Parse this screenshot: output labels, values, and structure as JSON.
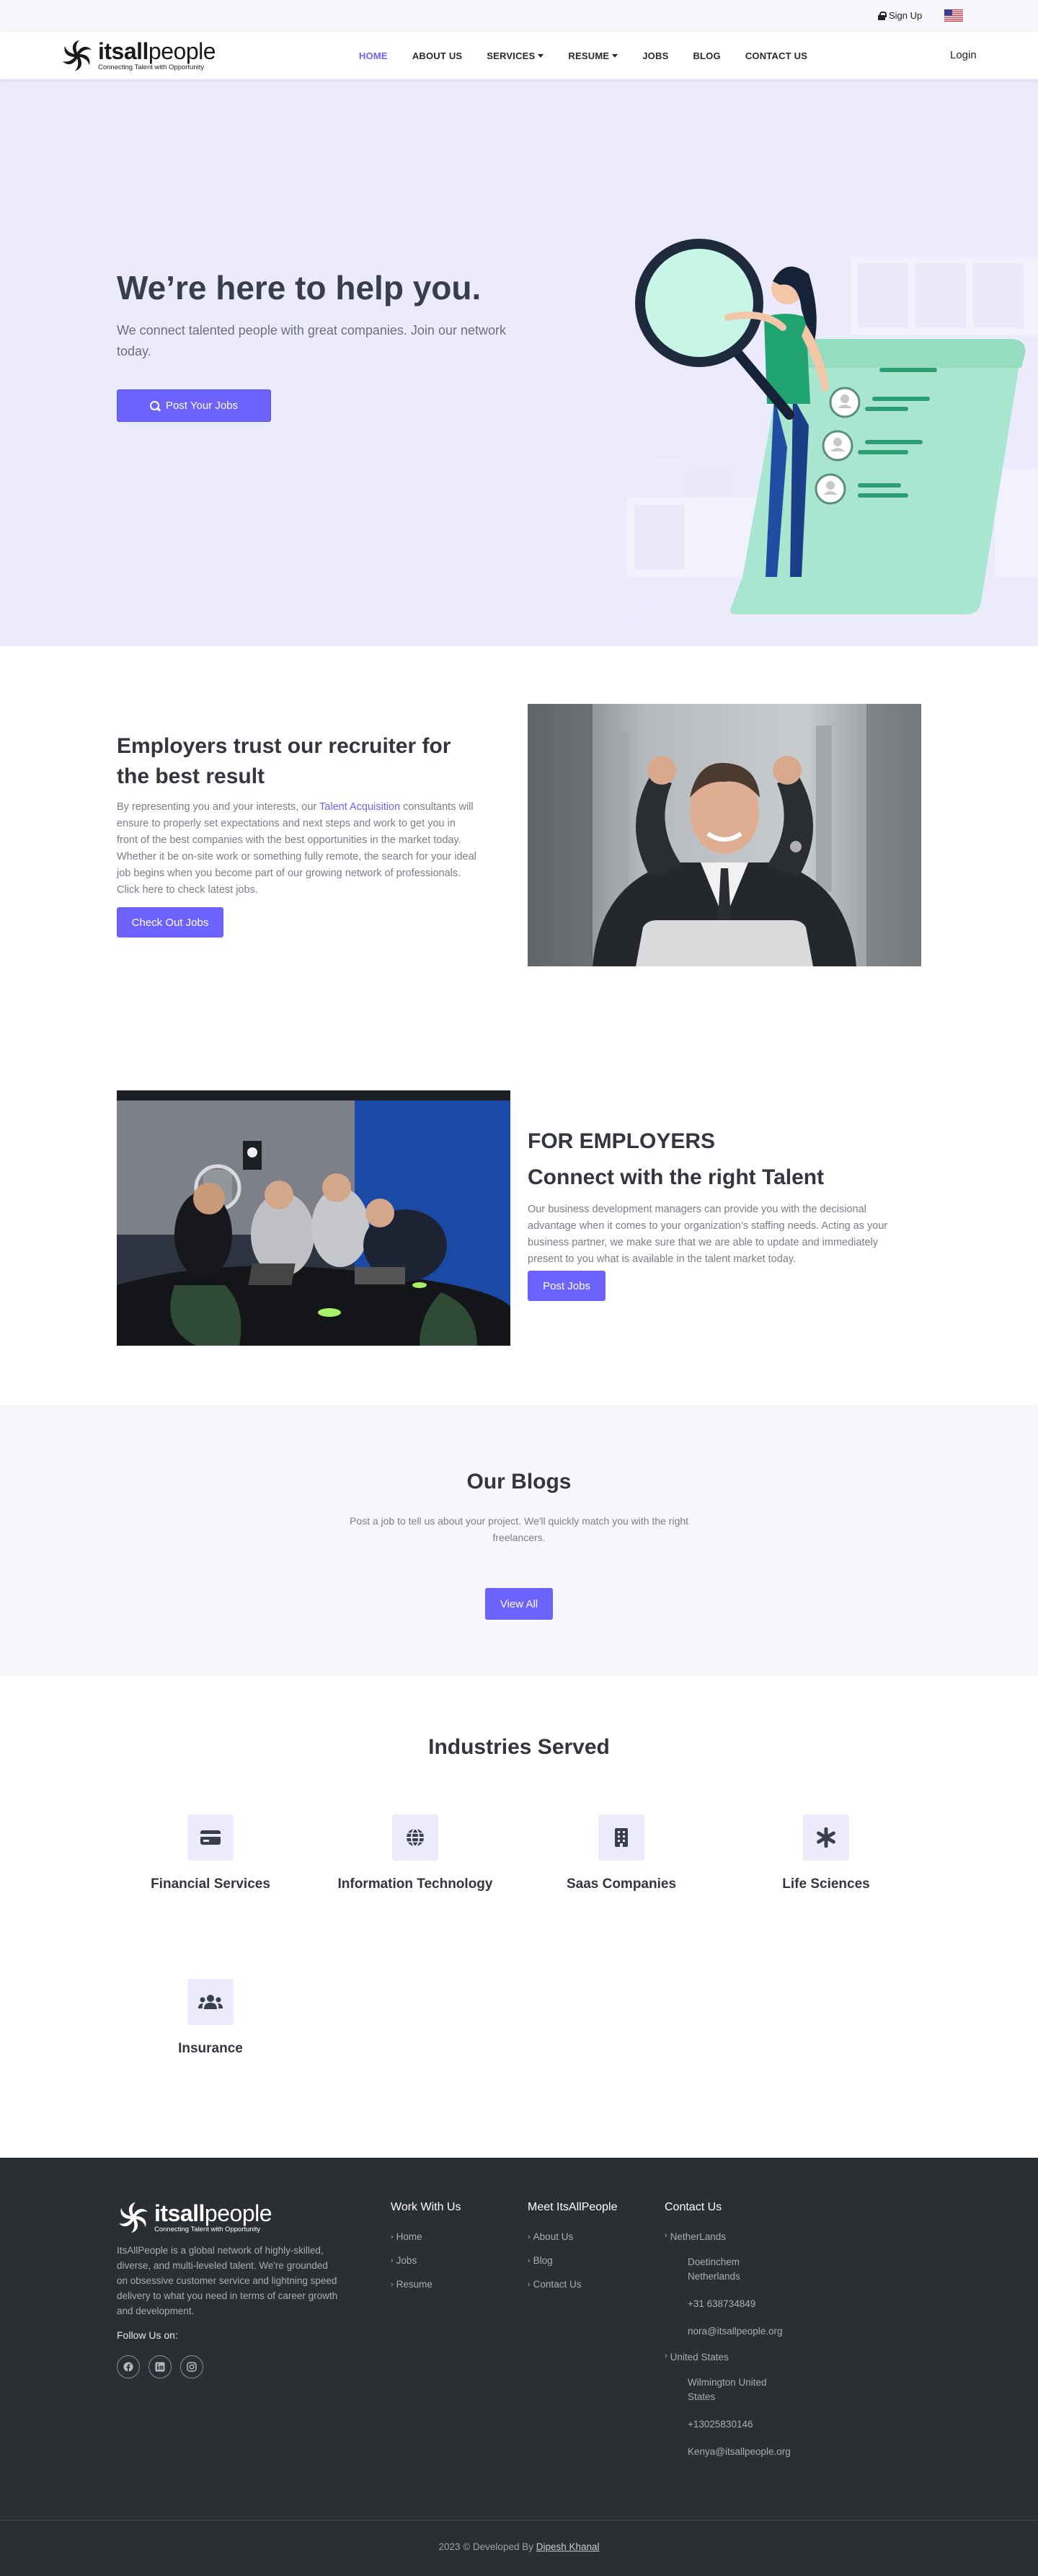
{
  "topbar": {
    "signup_label": "Sign Up",
    "flag_icon": "us-flag-icon"
  },
  "nav": {
    "logo_word_bold": "itsall",
    "logo_word_light": "people",
    "logo_tagline": "Connecting Talent with Opportunity",
    "items": [
      {
        "label": "HOME",
        "active": true,
        "dropdown": false
      },
      {
        "label": "ABOUT US",
        "active": false,
        "dropdown": false
      },
      {
        "label": "SERVICES",
        "active": false,
        "dropdown": true
      },
      {
        "label": "RESUME",
        "active": false,
        "dropdown": true
      },
      {
        "label": "JOBS",
        "active": false,
        "dropdown": false
      },
      {
        "label": "BLOG",
        "active": false,
        "dropdown": false
      },
      {
        "label": "CONTACT US",
        "active": false,
        "dropdown": false
      }
    ],
    "login_label": "Login"
  },
  "hero": {
    "title": "We’re here to help you.",
    "lead": "We connect talented people with great companies. Join our network today.",
    "cta_label": "Post Your Jobs"
  },
  "trust": {
    "title": "Employers trust our recruiter for the best result",
    "body_before": "By representing you and your interests, our ",
    "body_highlight": "Talent Acquisition",
    "body_after": " consultants will ensure to properly set expectations and next steps and work to get you in front of the best companies with the best opportunities in the market today. Whether it be on-site work or something fully remote, the search for your ideal job begins when you become part of our growing network of professionals. Click here to check latest jobs.",
    "cta_label": "Check Out Jobs"
  },
  "for_employers": {
    "kicker": "FOR EMPLOYERS",
    "title": "Connect with the right Talent",
    "body": "Our business development managers can provide you with the decisional advantage when it comes to your organization’s staffing needs. Acting as your business partner, we make sure that we are able to update and immediately present to you what is available in the talent market today.",
    "cta_label": "Post Jobs"
  },
  "blogs": {
    "title": "Our Blogs",
    "body": "Post a job to tell us about your project. We'll quickly match you with the right freelancers.",
    "cta_label": "View All"
  },
  "industries": {
    "title": "Industries Served",
    "items": [
      {
        "label": "Financial Services",
        "icon": "credit-card-icon"
      },
      {
        "label": "Information Technology",
        "icon": "globe-icon"
      },
      {
        "label": "Saas Companies",
        "icon": "building-icon"
      },
      {
        "label": "Life Sciences",
        "icon": "asterisk-icon"
      },
      {
        "label": "Insurance",
        "icon": "users-icon"
      }
    ]
  },
  "footer": {
    "about": "ItsAllPeople is a global network of highly-skilled, diverse, and multi-leveled talent. We're grounded on obsessive customer service and lightning speed delivery to what you need in terms of career growth and development.",
    "follow_label": "Follow Us on:",
    "socials": [
      "facebook-icon",
      "linkedin-icon",
      "instagram-icon"
    ],
    "col_work": {
      "title": "Work With Us",
      "links": [
        "Home",
        "Jobs",
        "Resume"
      ]
    },
    "col_meet": {
      "title": "Meet ItsAllPeople",
      "links": [
        "About Us",
        "Blog",
        "Contact Us"
      ]
    },
    "contact": {
      "title": "Contact Us",
      "nl_label": "NetherLands",
      "nl_address": "Doetinchem Netherlands",
      "nl_phone": "+31 638734849",
      "nl_email": "nora@itsallpeople.org",
      "us_label": "United States",
      "us_address": "Wilmington United States",
      "us_phone": "+13025830146",
      "us_email": "Kenya@itsallpeople.org"
    },
    "copyright_prefix": "2023 © Developed By ",
    "developer": "Dipesh Khanal"
  },
  "colors": {
    "accent": "#6c63ff",
    "hero_bg": "#eceafd",
    "footer_bg": "#2b2f33",
    "illustration_mint": "#a8e6cf"
  }
}
